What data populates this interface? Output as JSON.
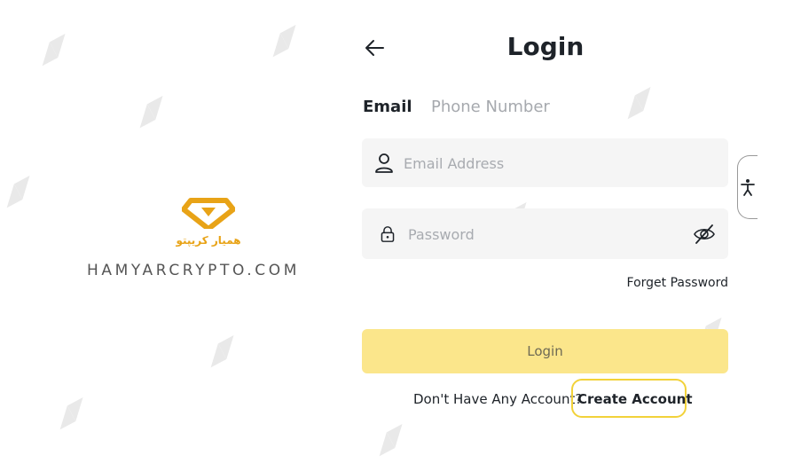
{
  "brand": {
    "arabic_name": "همیار کریپتو",
    "domain": "HAMYARCRYPTO.COM",
    "accent": "#e8a317"
  },
  "header": {
    "back_icon": "arrow-left-icon",
    "title": "Login"
  },
  "tabs": [
    {
      "label": "Email",
      "active": true
    },
    {
      "label": "Phone Number",
      "active": false
    }
  ],
  "form": {
    "email_placeholder": "Email Address",
    "password_placeholder": "Password",
    "forget_label": "Forget Password",
    "login_label": "Login",
    "no_account_text": "Don't Have Any Account?",
    "create_account_label": "Create Account"
  },
  "colors": {
    "login_button": "#fbe68b",
    "highlight": "#f2d23a",
    "input_bg": "#f5f5f5"
  },
  "accessibility": {
    "icon": "accessibility-icon"
  }
}
